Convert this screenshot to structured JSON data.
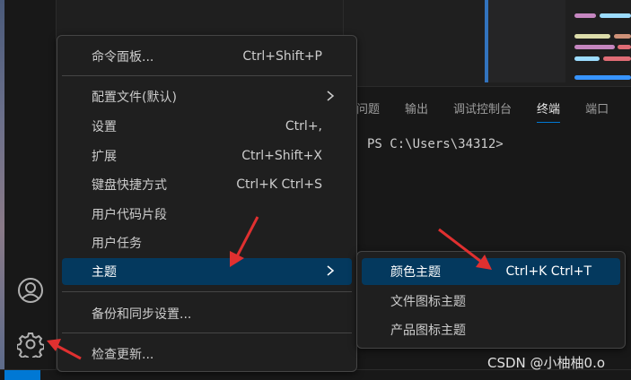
{
  "panel": {
    "tabs": [
      "问题",
      "输出",
      "调试控制台",
      "终端",
      "端口"
    ],
    "active_tab": "终端",
    "terminal_prompt": "PS C:\\Users\\34312>"
  },
  "manage_menu": {
    "items": [
      {
        "label": "命令面板...",
        "shortcut": "Ctrl+Shift+P"
      },
      {
        "label": "配置文件(默认)",
        "submenu": true
      },
      {
        "label": "设置",
        "shortcut": "Ctrl+,"
      },
      {
        "label": "扩展",
        "shortcut": "Ctrl+Shift+X"
      },
      {
        "label": "键盘快捷方式",
        "shortcut": "Ctrl+K Ctrl+S"
      },
      {
        "label": "用户代码片段"
      },
      {
        "label": "用户任务"
      },
      {
        "label": "主题",
        "submenu": true,
        "highlighted": true
      },
      {
        "label": "备份和同步设置..."
      },
      {
        "label": "检查更新..."
      }
    ]
  },
  "theme_submenu": {
    "items": [
      {
        "label": "颜色主题",
        "shortcut": "Ctrl+K Ctrl+T",
        "highlighted": true
      },
      {
        "label": "文件图标主题"
      },
      {
        "label": "产品图标主题"
      }
    ]
  },
  "activity_bar": {
    "icons": [
      "account-icon",
      "manage-gear-icon"
    ]
  },
  "watermark": "CSDN @小柚柚0.o",
  "colors": {
    "highlight": "#04395e",
    "accent": "#0078d4",
    "annotation_arrow": "#e03030"
  }
}
